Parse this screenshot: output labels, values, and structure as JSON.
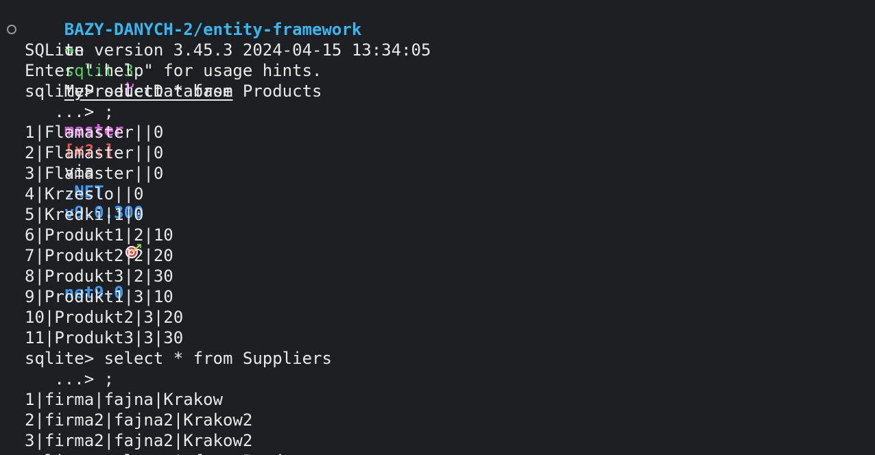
{
  "prompt": {
    "directory": "BAZY-DANYCH-2/entity-framework",
    "on": "on",
    "branch_icon": "git-branch-icon",
    "branch": "master",
    "git_status": "[✘?⇣]",
    "via": "via",
    "dotnet_label": ".NET",
    "dotnet_version": "v9.0.300",
    "target_icon": "target-icon",
    "target_framework": "net9.0"
  },
  "command": {
    "arrow": "➜",
    "program": "sqlite3",
    "argument": "MyProductDatabase"
  },
  "output_lines": [
    "SQLite version 3.45.3 2024-04-15 13:34:05",
    "Enter \".help\" for usage hints.",
    "sqlite> select * from Products",
    "   ...> ;",
    "1|Flamaster||0",
    "2|Flamaster||0",
    "3|Flamaster||0",
    "4|Krzeslo||0",
    "5|Kredki|1|0",
    "6|Produkt1|2|10",
    "7|Produkt2|2|20",
    "8|Produkt3|2|30",
    "9|Produkt1|3|10",
    "10|Produkt2|3|20",
    "11|Produkt3|3|30",
    "sqlite> select * from Suppliers",
    "   ...> ;",
    "1|firma|fajna|Krakow",
    "2|firma2|fajna2|Krakow2",
    "3|firma2|fajna2|Krakow2",
    "sqlite> select * from Products"
  ]
}
